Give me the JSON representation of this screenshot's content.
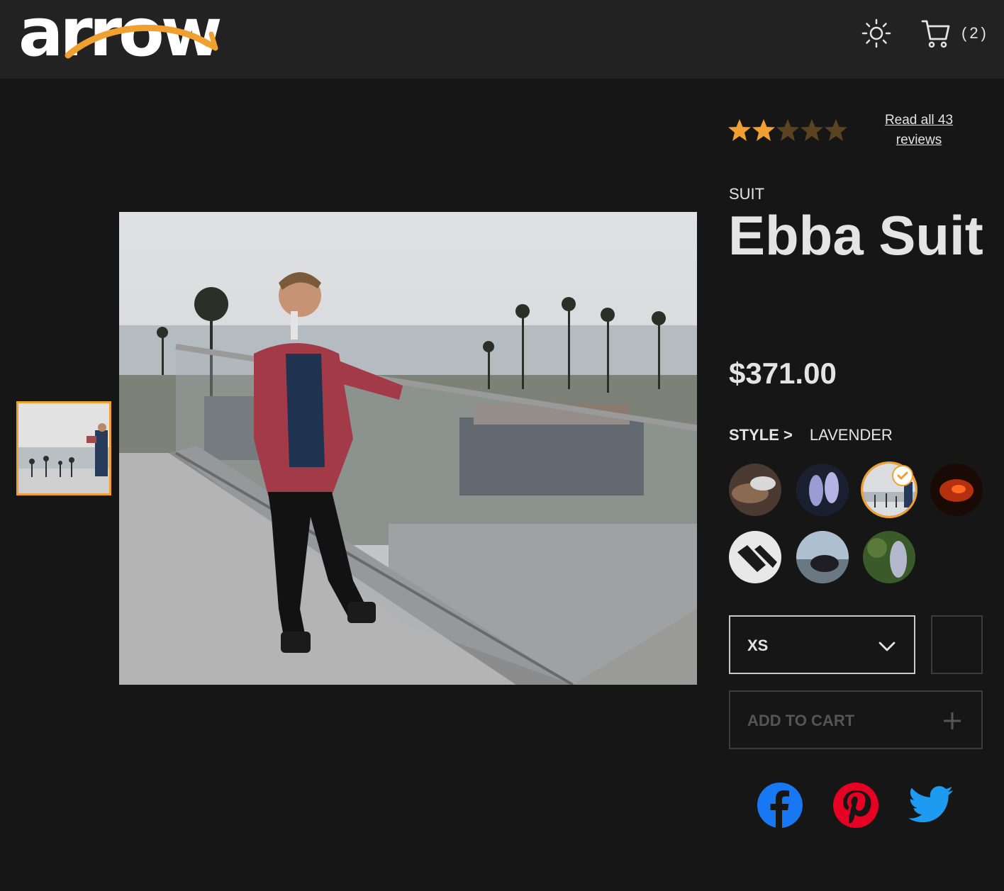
{
  "header": {
    "logo_text": "arrow",
    "theme_toggle_icon": "sun-icon",
    "cart_icon": "cart-icon",
    "cart_count": "(2)"
  },
  "gallery": {
    "thumbnails_count": 1,
    "selected_thumbnail": 1,
    "main_image_description_icon": "product-photo"
  },
  "product": {
    "rating": {
      "value": 2.5,
      "max": 5
    },
    "reviews_link": "Read all 43 reviews",
    "category": "SUIT",
    "title": "Ebba Suit",
    "price": "$371.00",
    "style_label": "STYLE >",
    "style_value": "LAVENDER",
    "swatch_count": 7,
    "selected_swatch": 3,
    "size": "XS",
    "add_to_cart": "ADD TO CART"
  },
  "social": [
    "facebook-icon",
    "pinterest-icon",
    "twitter-icon"
  ],
  "colors": {
    "accent": "#f0a030",
    "background": "#161616",
    "header": "#222222",
    "star_filled": "#f0a030",
    "star_empty": "#5a4320",
    "facebook": "#1877f2",
    "pinterest": "#e60023",
    "twitter": "#1d9bf0"
  }
}
